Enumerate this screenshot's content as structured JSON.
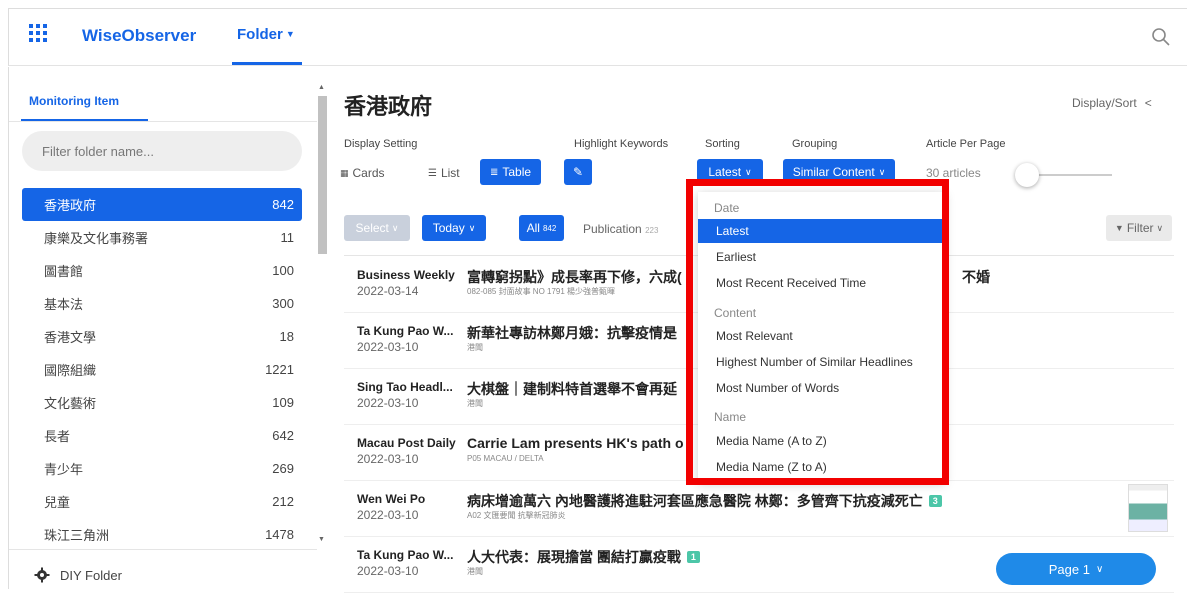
{
  "header": {
    "brand": "WiseObserver",
    "folder_menu": "Folder",
    "icons": [
      "apps-grid-icon",
      "search-icon"
    ]
  },
  "sidebar": {
    "tab": "Monitoring Item",
    "filter_placeholder": "Filter folder name...",
    "items": [
      {
        "label": "香港政府",
        "count": "842",
        "active": true
      },
      {
        "label": "康樂及文化事務署",
        "count": "11"
      },
      {
        "label": "圖書館",
        "count": "100"
      },
      {
        "label": "基本法",
        "count": "300"
      },
      {
        "label": "香港文學",
        "count": "18"
      },
      {
        "label": "國際組織",
        "count": "1221"
      },
      {
        "label": "文化藝術",
        "count": "109"
      },
      {
        "label": "長者",
        "count": "642"
      },
      {
        "label": "青少年",
        "count": "269"
      },
      {
        "label": "兒童",
        "count": "212"
      },
      {
        "label": "珠江三角洲",
        "count": "1478"
      }
    ],
    "diy_folder": "DIY Folder"
  },
  "main": {
    "title": "香港政府",
    "display_sort": "Display/Sort",
    "controls": {
      "display_setting_label": "Display Setting",
      "cards": "Cards",
      "list": "List",
      "table": "Table",
      "highlight_label": "Highlight Keywords",
      "sorting_label": "Sorting",
      "sorting_value": "Latest",
      "grouping_label": "Grouping",
      "grouping_value": "Similar Content",
      "per_page_label": "Article Per Page",
      "per_page_value": "30 articles"
    },
    "filters": {
      "select": "Select",
      "today": "Today",
      "all": "All",
      "all_count": "842",
      "publication": "Publication",
      "publication_count": "223",
      "filter": "Filter"
    },
    "articles": [
      {
        "source": "Business Weekly",
        "date": "2022-03-14",
        "headline": "富轉窮拐點》成長率再下修，六成(",
        "headline_tail": "不婚",
        "sub": "082-085 封面故事 NO 1791 楊少強普甄暉"
      },
      {
        "source": "Ta Kung Pao W...",
        "date": "2022-03-10",
        "headline": "新華社專訪林鄭月娥：抗擊疫情是",
        "sub": "港聞"
      },
      {
        "source": "Sing Tao Headl...",
        "date": "2022-03-10",
        "headline": "大棋盤｜建制料特首選舉不會再延",
        "sub": "港聞"
      },
      {
        "source": "Macau Post Daily",
        "date": "2022-03-10",
        "headline": "Carrie Lam presents HK's path o",
        "sub": "P05 MACAU / DELTA"
      },
      {
        "source": "Wen Wei Po",
        "date": "2022-03-10",
        "headline": "病床增逾萬六 內地醫護將進駐河套區應急醫院 林鄭：多管齊下抗疫減死亡",
        "badge": "3",
        "sub": "A02 文匯要聞 抗擊新冠肺炎"
      },
      {
        "source": "Ta Kung Pao W...",
        "date": "2022-03-10",
        "headline": "人大代表：展現擔當 團結打贏疫戰",
        "badge": "1",
        "sub": "港聞"
      }
    ],
    "pager": "Page 1"
  },
  "sort_dropdown": {
    "group_date": "Date",
    "latest": "Latest",
    "earliest": "Earliest",
    "recent_received": "Most Recent Received Time",
    "group_content": "Content",
    "most_relevant": "Most Relevant",
    "highest_similar": "Highest Number of Similar Headlines",
    "most_words": "Most Number of Words",
    "group_name": "Name",
    "media_az": "Media Name (A to Z)",
    "media_za": "Media Name (Z to A)",
    "highlight_color": "#f20000"
  },
  "colors": {
    "accent": "#1565e6",
    "badge": "#4cc6a8",
    "pager": "#1f8ae8"
  }
}
